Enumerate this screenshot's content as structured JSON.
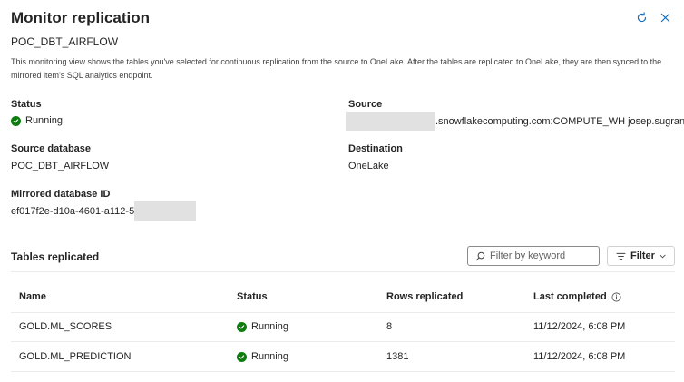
{
  "header": {
    "title": "Monitor replication",
    "subtitle": "POC_DBT_AIRFLOW",
    "description": "This monitoring view shows the tables you've selected for continuous replication from the source to OneLake. After the tables are replicated to OneLake, they are then synced to the mirrored item's SQL analytics endpoint.",
    "refresh_icon": "refresh-icon",
    "close_icon": "close-icon"
  },
  "details": {
    "status_label": "Status",
    "status_value": "Running",
    "source_label": "Source",
    "source_value": ".snowflakecomputing.com:COMPUTE_WH josep.sugranes",
    "source_db_label": "Source database",
    "source_db_value": "POC_DBT_AIRFLOW",
    "destination_label": "Destination",
    "destination_value": "OneLake",
    "mirrored_id_label": "Mirrored database ID",
    "mirrored_id_value": "ef017f2e-d10a-4601-a112-5"
  },
  "tables": {
    "title": "Tables replicated",
    "filter_placeholder": "Filter by keyword",
    "filter_button": "Filter",
    "columns": [
      "Name",
      "Status",
      "Rows replicated",
      "Last completed"
    ],
    "rows": [
      {
        "name": "GOLD.ML_SCORES",
        "status": "Running",
        "rows": "8",
        "last_completed": "11/12/2024, 6:08 PM"
      },
      {
        "name": "GOLD.ML_PREDICTION",
        "status": "Running",
        "rows": "1381",
        "last_completed": "11/12/2024, 6:08 PM"
      }
    ]
  },
  "colors": {
    "running": "#107c10",
    "accent": "#0f6cbd"
  }
}
